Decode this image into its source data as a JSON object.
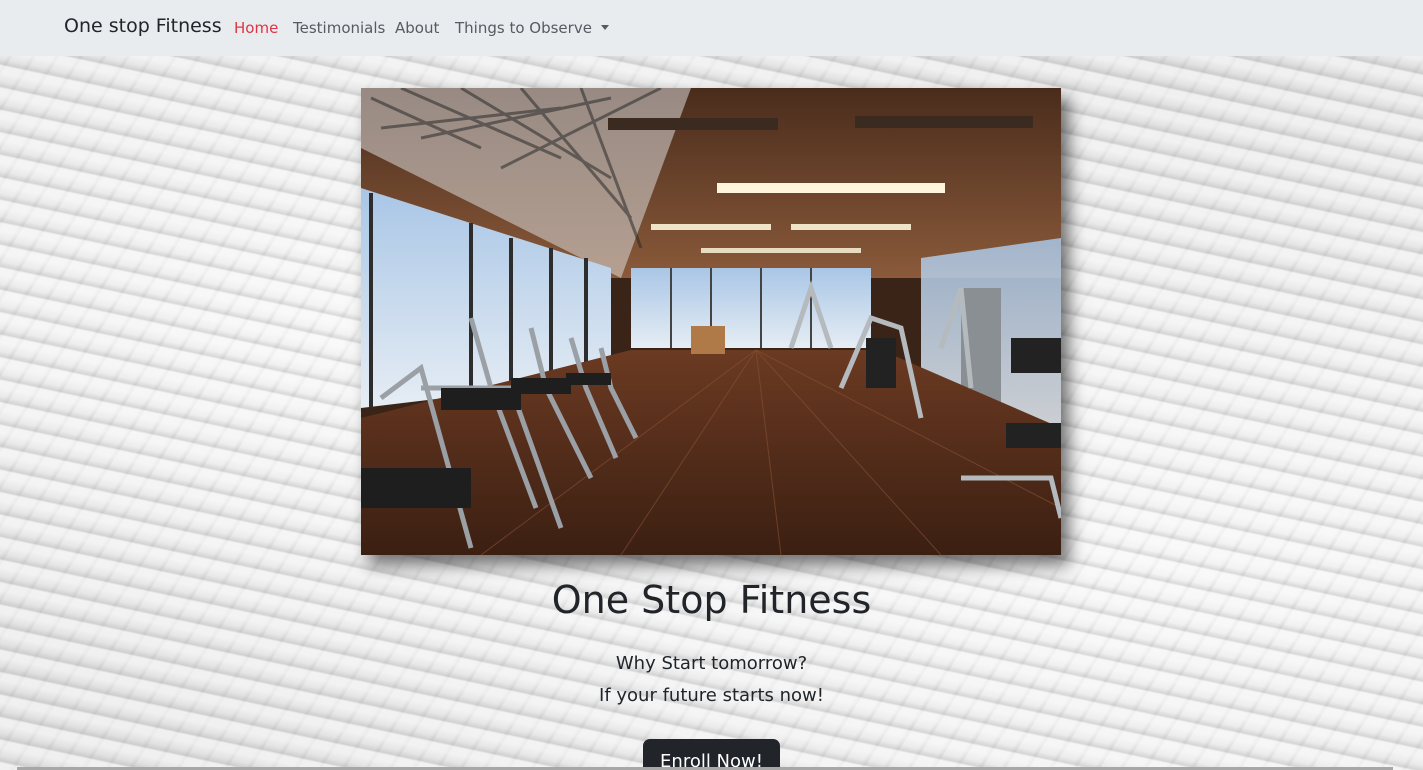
{
  "navbar": {
    "brand": "One stop Fitness",
    "links": [
      {
        "label": "Home",
        "active": true
      },
      {
        "label": "Testimonials",
        "active": false
      },
      {
        "label": "About",
        "active": false
      },
      {
        "label": "Things to Observe",
        "active": false,
        "dropdown": true
      }
    ],
    "active_color": "#dc3545",
    "background": "#e9ecef"
  },
  "hero": {
    "image_alt": "gym-interior-photo",
    "title": "One Stop Fitness",
    "tagline_line1": "Why Start tomorrow?",
    "tagline_line2": "If your future starts now!",
    "cta_label": "Enroll Now!"
  },
  "icons": {
    "dropdown": "caret-down-icon"
  }
}
